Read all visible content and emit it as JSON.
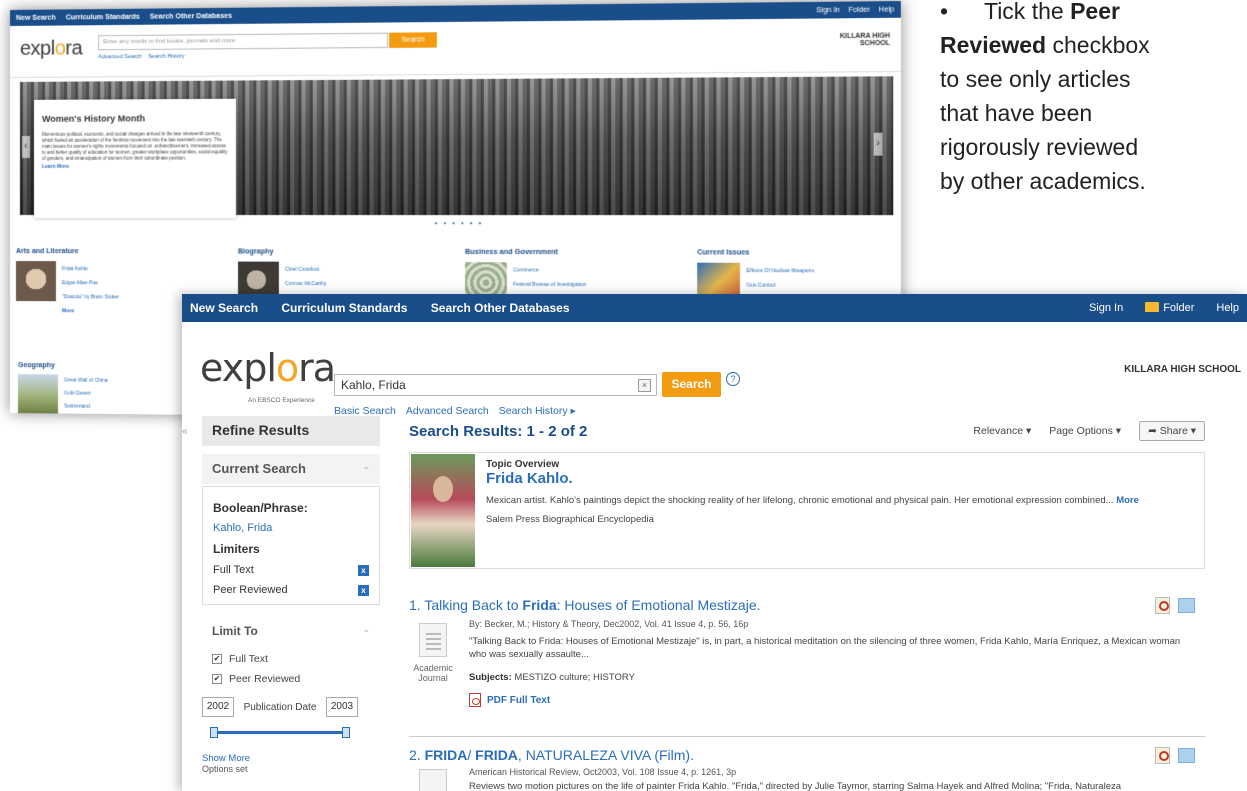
{
  "callout": {
    "bullet": "•",
    "line1": "Tick the ",
    "peer": "Peer",
    "reviewed": "Reviewed",
    "rest1": " checkbox",
    "rest2": "to see only articles",
    "rest3": "that have been",
    "rest4": "rigorously reviewed",
    "rest5": "by other academics."
  },
  "back": {
    "nav": [
      "New Search",
      "Curriculum Standards",
      "Search Other Databases"
    ],
    "top_right": [
      "Sign In",
      "Folder",
      "Help"
    ],
    "logo_prefix": "expl",
    "logo_o": "o",
    "logo_suffix": "ra",
    "search_placeholder": "Enter any words to find books, journals and more",
    "search_button": "Search",
    "links": [
      "Advanced Search",
      "Search History"
    ],
    "school": "KILLARA HIGH SCHOOL",
    "banner_title": "Women's History Month",
    "banner_text": "Momentous political, economic, and social changes arrived in the late nineteenth century, which fueled an acceleration of the feminist movement into the late twentieth century. The main issues for women's rights movements focused on: enfranchisement, increased access to and better quality of education for women, greater workplace opportunities, social equality of genders, and emancipation of women from their subordinate position.",
    "banner_link": "Learn More",
    "dots": "• • • • • •",
    "categories": [
      {
        "title": "Arts and Literature",
        "links": [
          "Frida Kahlo",
          "Edgar Allan Poe",
          "\"Dracula\" by Bram Stoker",
          "More"
        ]
      },
      {
        "title": "Biography",
        "links": [
          "Chief Crowfoot",
          "Cormac McCarthy"
        ]
      },
      {
        "title": "Business and Government",
        "links": [
          "Commerce",
          "Federal Bureau of Investigation"
        ]
      },
      {
        "title": "Current Issues",
        "links": [
          "Effects Of Nuclear Weapons",
          "Gun Control"
        ]
      }
    ],
    "geography": {
      "title": "Geography",
      "links": [
        "Great Wall of China",
        "Gobi Desert",
        "Switzerland"
      ]
    }
  },
  "front": {
    "nav": [
      "New Search",
      "Curriculum Standards",
      "Search Other Databases"
    ],
    "top_right": [
      "Sign In",
      "Folder",
      "Help"
    ],
    "logo_prefix": "expl",
    "logo_o": "o",
    "logo_suffix": "ra",
    "logo_sub": "An EBSCO Experience",
    "query": "Kahlo, Frida",
    "clear": "×",
    "search_button": "Search",
    "help": "?",
    "links": [
      "Basic Search",
      "Advanced Search",
      "Search History ▸"
    ],
    "school": "KILLARA HIGH SCHOOL",
    "collapse": "«",
    "sidebar": {
      "refine": "Refine Results",
      "current_search": "Current Search",
      "boolean_label": "Boolean/Phrase:",
      "boolean_value": "Kahlo, Frida",
      "limiters_label": "Limiters",
      "limiters": [
        "Full Text",
        "Peer Reviewed"
      ],
      "remove": "x",
      "limit_to": "Limit To",
      "checkboxes": [
        {
          "label": "Full Text",
          "checked": "✔"
        },
        {
          "label": "Peer Reviewed",
          "checked": "✔"
        }
      ],
      "date_from": "2002",
      "date_label": "Publication Date",
      "date_to": "2003",
      "show_more": "Show More",
      "options_set": "Options set"
    },
    "results": {
      "title": "Search Results: 1 - 2 of 2",
      "sort": "Relevance ▾",
      "page_options": "Page Options ▾",
      "share": "Share ▾",
      "overview_label": "Topic Overview",
      "overview_title": "Frida Kahlo.",
      "overview_desc": "Mexican artist. Kahlo's paintings depict the shocking reality of her lifelong, chronic emotional and physical pain. Her emotional expression combined...",
      "overview_more": "More",
      "overview_source": "Salem Press Biographical Encyclopedia",
      "item1": {
        "number": "1.",
        "title_pre": "Talking Back to ",
        "title_bold": "Frida",
        "title_post": ": Houses of Emotional Mestizaje.",
        "meta": "By: Becker, M.; History & Theory, Dec2002, Vol. 41 Issue 4, p. 56, 16p",
        "abstract": "\"Talking Back to Frida: Houses of Emotional Mestizaje\" is, in part, a historical meditation on the silencing of three women, Frida Kahlo, María Enriquez, a Mexican woman who was sexually assaulte...",
        "doc_type": "Academic Journal",
        "subjects_label": "Subjects:",
        "subjects": "MESTIZO culture; HISTORY",
        "pdf": "PDF Full Text"
      },
      "item2": {
        "number": "2.",
        "title_bold": "FRIDA",
        "title_sep": "/ ",
        "title_bold2": "FRIDA",
        "title_post": ", NATURALEZA VIVA (Film).",
        "meta": "American Historical Review, Oct2003, Vol. 108 Issue 4, p. 1261, 3p",
        "abstract": "Reviews two motion pictures on the life of painter Frida Kahlo. \"Frida,\" directed by Julie Taymor, starring Salma Hayek and Alfred Molina; \"Frida, Naturaleza"
      }
    }
  }
}
